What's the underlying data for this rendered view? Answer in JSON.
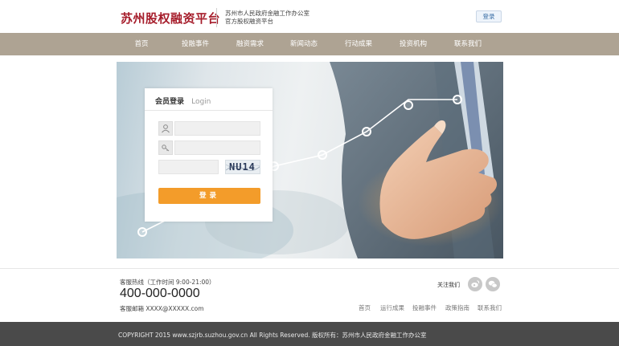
{
  "header": {
    "brand": "苏州股权融资平台",
    "desc_line1": "苏州市人民政府金融工作办公室",
    "desc_line2": "官方股权融资平台",
    "login_button": "登录"
  },
  "nav": {
    "items": [
      {
        "label": "首页"
      },
      {
        "label": "投融事件"
      },
      {
        "label": "融资需求"
      },
      {
        "label": "新闻动态"
      },
      {
        "label": "行动成果"
      },
      {
        "label": "投资机构"
      },
      {
        "label": "联系我们"
      }
    ]
  },
  "login": {
    "title": "会员登录",
    "subtitle": "Login",
    "username_placeholder": "",
    "password_placeholder": "",
    "captcha_placeholder": "",
    "captcha_text": "NU14",
    "submit": "登录"
  },
  "footer": {
    "hotline_label": "客服热线（工作时间 9:00-21:00）",
    "hotline_number": "400-000-0000",
    "email_line": "客服邮箱 XXXX@XXXXX.com",
    "follow_label": "关注我们",
    "links": [
      {
        "label": "首页"
      },
      {
        "label": "运行成果"
      },
      {
        "label": "投融事件"
      },
      {
        "label": "政策指南"
      },
      {
        "label": "联系我们"
      }
    ],
    "copyright": "COPYRIGHT 2015 www.szjrb.suzhou.gov.cn All Rights Reserved.  版权所有：苏州市人民政府金融工作办公室"
  },
  "colors": {
    "brand": "#a61d2b",
    "nav_bg": "#aea393",
    "accent_button": "#f39c2a",
    "copyright_bg": "#4a4a4a"
  },
  "icons": {
    "username": "user-icon",
    "password": "key-icon",
    "weibo": "weibo-icon",
    "wechat": "wechat-icon"
  }
}
